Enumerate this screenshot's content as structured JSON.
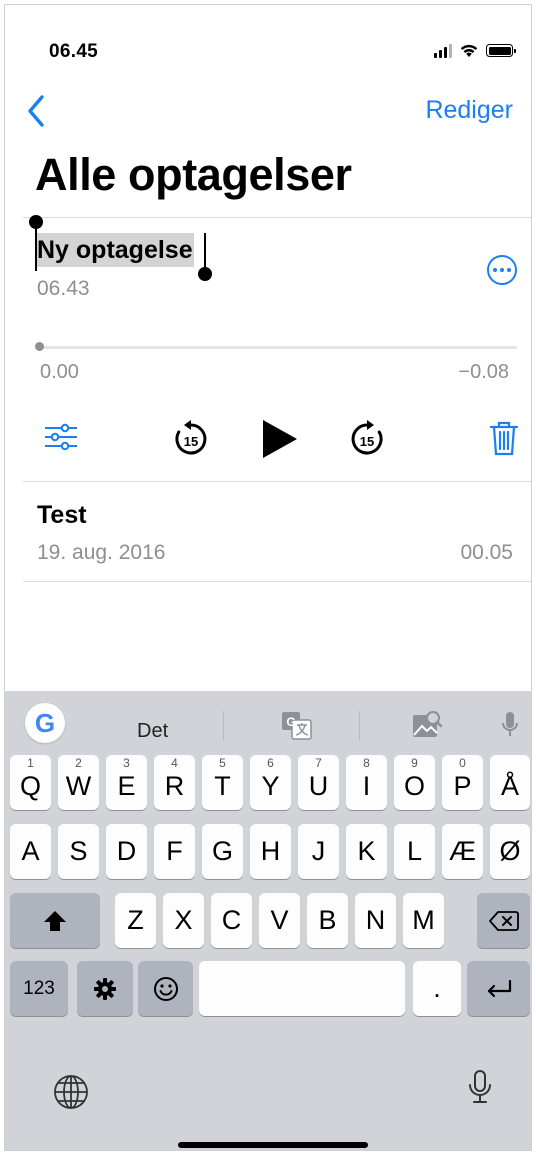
{
  "status_bar": {
    "time": "06.45"
  },
  "nav": {
    "edit_label": "Rediger"
  },
  "page_title": "Alle optagelser",
  "recordings": [
    {
      "name": "Ny optagelse",
      "date": "06.43",
      "selected": true
    },
    {
      "name": "Test",
      "date": "19. aug. 2016",
      "duration": "00.05"
    }
  ],
  "player": {
    "elapsed": "0.00",
    "remaining": "−0.08",
    "skip_back_seconds": "15",
    "skip_forward_seconds": "15",
    "progress": 0.0
  },
  "keyboard": {
    "suggestion_word": "Det",
    "row1": [
      {
        "key": "Q",
        "hint": "1"
      },
      {
        "key": "W",
        "hint": "2"
      },
      {
        "key": "E",
        "hint": "3"
      },
      {
        "key": "R",
        "hint": "4"
      },
      {
        "key": "T",
        "hint": "5"
      },
      {
        "key": "Y",
        "hint": "6"
      },
      {
        "key": "U",
        "hint": "7"
      },
      {
        "key": "I",
        "hint": "8"
      },
      {
        "key": "O",
        "hint": "9"
      },
      {
        "key": "P",
        "hint": "0"
      },
      {
        "key": "Å",
        "hint": ""
      }
    ],
    "row2": [
      "A",
      "S",
      "D",
      "F",
      "G",
      "H",
      "J",
      "K",
      "L",
      "Æ",
      "Ø"
    ],
    "row3": [
      "Z",
      "X",
      "C",
      "V",
      "B",
      "N",
      "M"
    ],
    "numbers_label": "123",
    "period_label": ".",
    "google_letter": "G"
  },
  "colors": {
    "accent": "#1a7ff0",
    "secondary_text": "#8e8e93",
    "selection": "#d4d4d4",
    "keyboard_bg": "#d1d3d9"
  }
}
